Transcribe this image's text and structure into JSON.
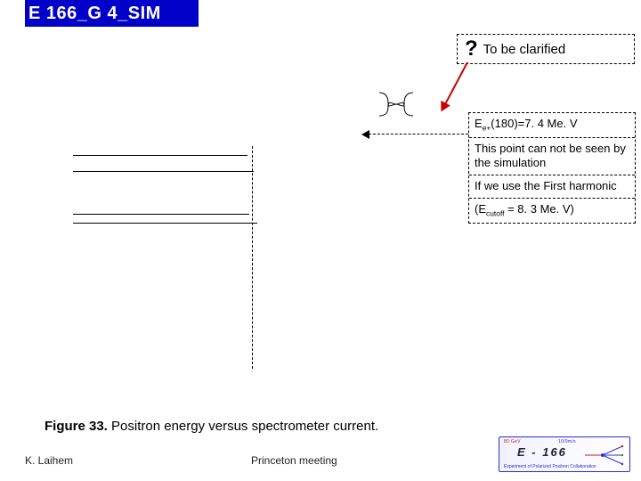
{
  "title": "E 166_G 4_SIM",
  "clarify": {
    "mark": "?",
    "text": "To be clarified"
  },
  "energy_line_html": "E<sub>e+</sub>(180)=7. 4 Me. V",
  "point_note": "This point can not be seen by the simulation",
  "harmonic_note": "If we use the First harmonic",
  "cutoff_html": "(E<sub>cutoff</sub> = 8. 3 Me. V)",
  "figure": {
    "label": "Figure 33.",
    "caption": "Positron energy versus spectrometer current."
  },
  "footer": {
    "author": "K. Laihem",
    "meeting": "Princeton meeting"
  },
  "logo": {
    "top": "80 GeV",
    "top2": "10/9m/s",
    "main": "E - 166",
    "bottom": "Experiment of Polarized Positron Collaboration"
  }
}
